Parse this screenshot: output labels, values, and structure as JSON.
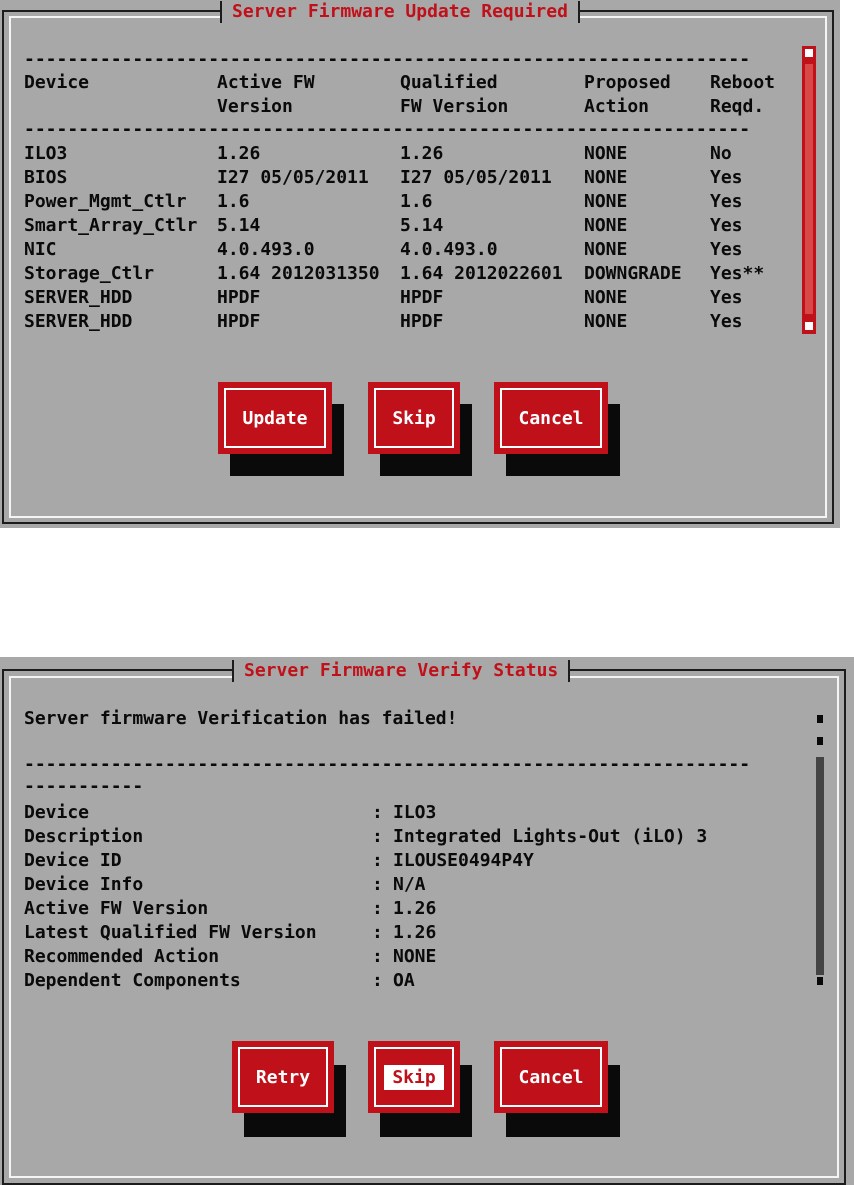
{
  "update_dialog": {
    "title": "Server Firmware Update Required",
    "dashes": "-------------------------------------------------------------------",
    "headers": {
      "device": "Device",
      "active": [
        "Active FW",
        "Version"
      ],
      "qualified": [
        "Qualified",
        "FW Version"
      ],
      "proposed": [
        "Proposed",
        "Action"
      ],
      "reboot": [
        "Reboot",
        "Reqd."
      ]
    },
    "rows": [
      [
        "ILO3",
        "1.26",
        "1.26",
        "NONE",
        "No"
      ],
      [
        "BIOS",
        "I27 05/05/2011",
        "I27 05/05/2011",
        "NONE",
        "Yes"
      ],
      [
        "Power_Mgmt_Ctlr",
        "1.6",
        "1.6",
        "NONE",
        "Yes"
      ],
      [
        "Smart_Array_Ctlr",
        "5.14",
        "5.14",
        "NONE",
        "Yes"
      ],
      [
        "NIC",
        "4.0.493.0",
        "4.0.493.0",
        "NONE",
        "Yes"
      ],
      [
        "Storage_Ctlr",
        "1.64 2012031350",
        "1.64 2012022601",
        "DOWNGRADE",
        "Yes**"
      ],
      [
        "SERVER_HDD",
        "HPDF",
        "HPDF",
        "NONE",
        "Yes"
      ],
      [
        "SERVER_HDD",
        "HPDF",
        "HPDF",
        "NONE",
        "Yes"
      ]
    ],
    "buttons": {
      "update": "Update",
      "skip": "Skip",
      "cancel": "Cancel"
    }
  },
  "verify_dialog": {
    "title": "Server Firmware Verify Status",
    "message": "Server firmware Verification has failed!",
    "dashes_long": "-------------------------------------------------------------------",
    "dashes_short": "-----------",
    "details": [
      {
        "label": "Device",
        "value": "ILO3"
      },
      {
        "label": "Description",
        "value": "Integrated Lights-Out (iLO) 3"
      },
      {
        "label": "Device ID",
        "value": "ILOUSE0494P4Y"
      },
      {
        "label": "Device Info",
        "value": "N/A"
      },
      {
        "label": "Active FW Version",
        "value": "1.26"
      },
      {
        "label": "Latest Qualified FW Version",
        "value": "1.26"
      },
      {
        "label": "Recommended Action",
        "value": "NONE"
      },
      {
        "label": "Dependent Components",
        "value": "OA"
      }
    ],
    "separator": ":",
    "buttons": {
      "retry": "Retry",
      "skip": "Skip",
      "cancel": "Cancel"
    }
  },
  "colors": {
    "dialog_bg": "#a8a8a8",
    "accent_red": "#c0101a",
    "text": "#0a0a0a"
  }
}
